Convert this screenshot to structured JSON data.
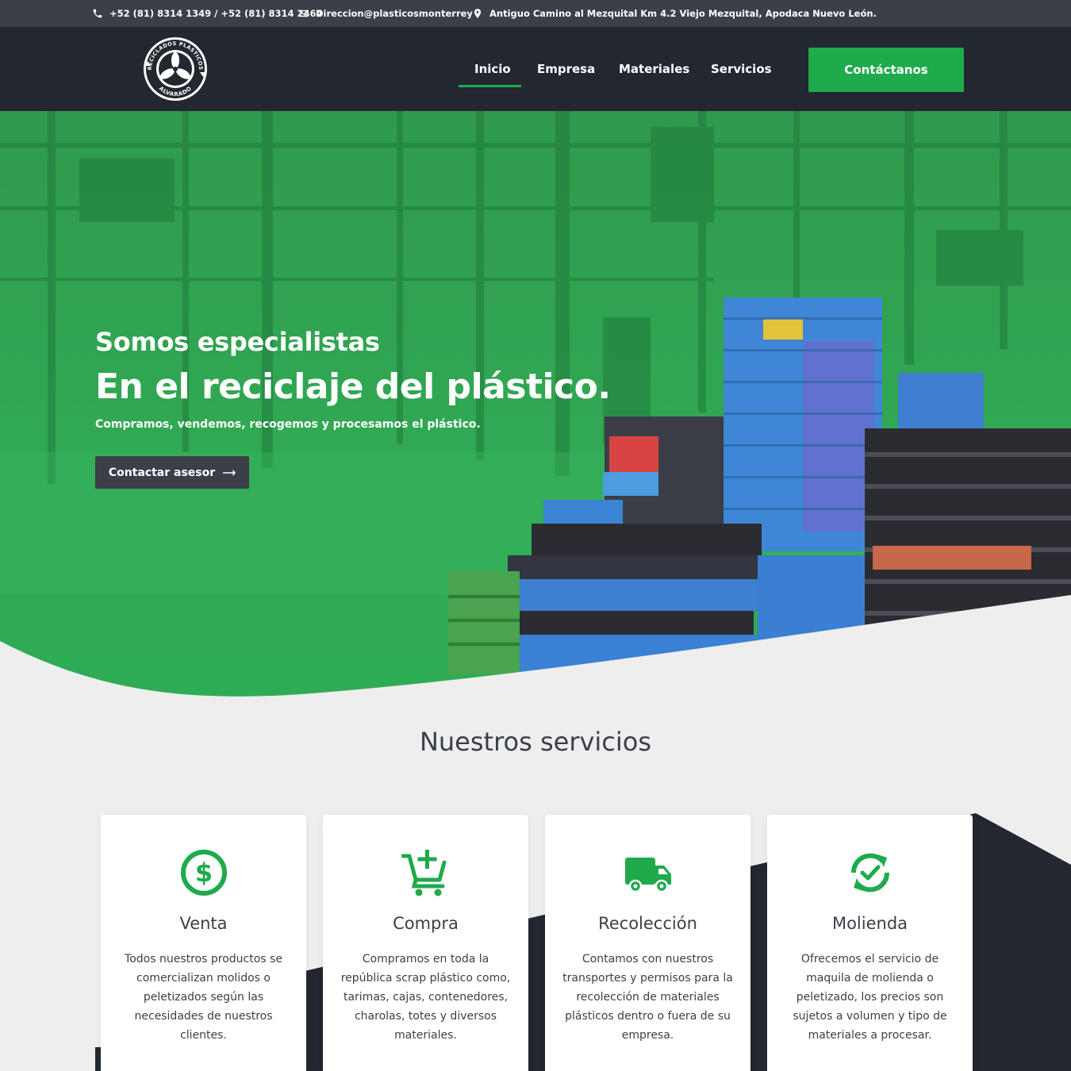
{
  "topbar": {
    "phone": "+52 (81) 8314 1349 / +52 (81) 8314 2464",
    "email": "Direccion@plasticosmonterrey",
    "address": "Antiguo Camino al Mezquital Km 4.2 Viejo Mezquital, Apodaca Nuevo León."
  },
  "logo": {
    "text_top": "RECICLADOS PLÁSTICOS",
    "text_bottom": "ALVARADO"
  },
  "nav": {
    "items": [
      {
        "label": "Inicio",
        "active": true
      },
      {
        "label": "Empresa"
      },
      {
        "label": "Materiales"
      },
      {
        "label": "Servicios"
      }
    ],
    "cta_label": "Contáctanos"
  },
  "hero": {
    "subtitle": "Somos especialistas",
    "title": "En el reciclaje del plástico.",
    "description": "Compramos, vendemos, recogemos y procesamos el plástico.",
    "button_label": "Contactar asesor"
  },
  "services": {
    "heading": "Nuestros servicios",
    "cards": [
      {
        "icon": "dollar-icon",
        "title": "Venta",
        "text": "Todos nuestros productos se comercializan molidos o peletizados según las necesidades de nuestros clientes."
      },
      {
        "icon": "cart-plus-icon",
        "title": "Compra",
        "text": "Compramos en toda la república scrap plástico como, tarimas, cajas, contenedores, charolas, totes y diversos materiales."
      },
      {
        "icon": "truck-icon",
        "title": "Recolección",
        "text": "Contamos con nuestros transportes y permisos para la recolección de materiales plásticos dentro o fuera de su empresa."
      },
      {
        "icon": "recycle-check-icon",
        "title": "Molienda",
        "text": "Ofrecemos el servicio de maquila de molienda o peletizado, los precios son sujetos a volumen y tipo de materiales a procesar."
      }
    ]
  },
  "colors": {
    "accent": "#1faa4b",
    "dark": "#232730",
    "topbar": "#3b3f47",
    "background": "#eeeeef"
  }
}
